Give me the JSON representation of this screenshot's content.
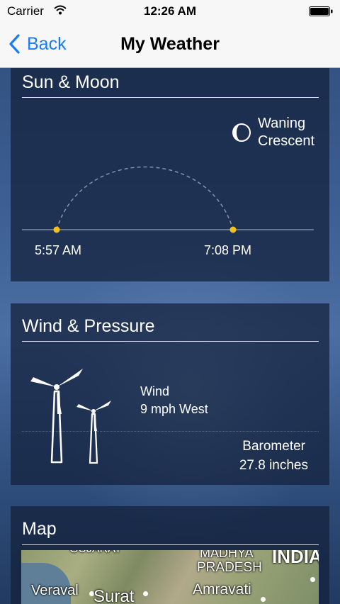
{
  "status_bar": {
    "carrier": "Carrier",
    "time": "12:26 AM"
  },
  "nav": {
    "back_label": "Back",
    "title": "My Weather",
    "accent_color": "#1a7cf4"
  },
  "sun_moon": {
    "title": "Sun & Moon",
    "moon_phase_line1": "Waning",
    "moon_phase_line2": "Crescent",
    "sunrise": "5:57 AM",
    "sunset": "7:08 PM"
  },
  "wind_pressure": {
    "title": "Wind & Pressure",
    "wind_label": "Wind",
    "wind_value": "9 mph West",
    "barometer_label": "Barometer",
    "barometer_value": "27.8 inches"
  },
  "map": {
    "title": "Map",
    "labels": {
      "gujarat": "GUJARAT",
      "madhya": "MADHYA",
      "pradesh": "PRADESH",
      "india": "INDIA",
      "veraval": "Veraval",
      "surat": "Surat",
      "amravati": "Amravati"
    }
  }
}
